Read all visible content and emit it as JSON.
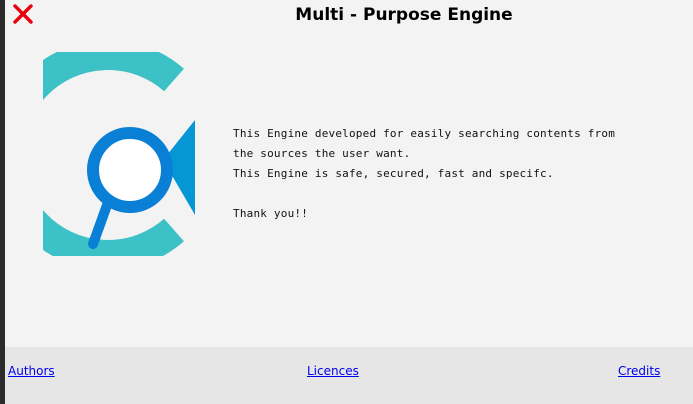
{
  "window": {
    "title": "Multi - Purpose Engine",
    "close_icon": "close-icon"
  },
  "logo": {
    "icon": "magnifier-logo-icon",
    "colors": {
      "ring": "#3cc1c7",
      "lens": "#0a7fd6",
      "arrow": "#0596d4"
    }
  },
  "description": {
    "line1": "This Engine developed for easily searching contents from the sources the user want.",
    "line2": "This Engine is safe, secured, fast and specifc.",
    "line3": "Thank you!!"
  },
  "footer": {
    "links": [
      {
        "label": "Authors"
      },
      {
        "label": "Licences"
      },
      {
        "label": "Credits"
      }
    ]
  },
  "colors": {
    "close": "#e8000b",
    "link": "#0000ee",
    "footer_bg": "#e6e6e6",
    "window_bg": "#f3f3f3"
  }
}
